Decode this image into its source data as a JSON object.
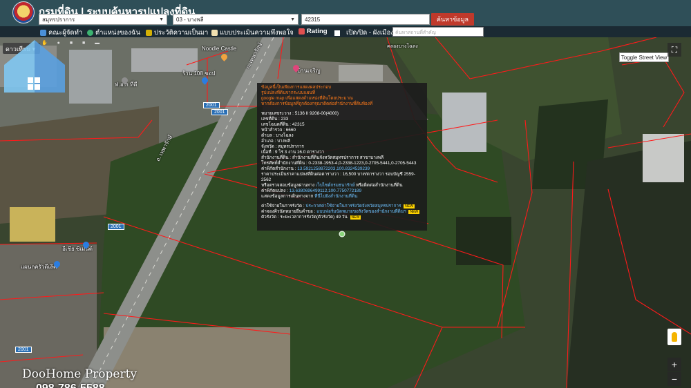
{
  "header": {
    "title": "กรมที่ดิน | ระบบค้นหารูปแปลงที่ดิน",
    "province_select": "สมุทรปราการ",
    "district_select": "03 - บางพลี",
    "parcel_input": "42315",
    "search_button": "ค้นหาข้อมูล"
  },
  "toolbar": {
    "items": [
      {
        "label": "คณะผู้จัดทำ",
        "icon": "team-icon"
      },
      {
        "label": "ตำแหน่งของฉัน",
        "icon": "location-icon"
      },
      {
        "label": "ประวัติความเป็นมา",
        "icon": "history-icon"
      },
      {
        "label": "แบบประเมินความพึงพอใจ",
        "icon": "survey-icon"
      },
      {
        "label": "Rating",
        "icon": "rating-icon"
      },
      {
        "label": "เปิด/ปิด - ผังเมือง",
        "icon": "checkbox-icon"
      }
    ],
    "place_search_placeholder": "ค้นหาสถานที่สำคัญ"
  },
  "map": {
    "map_type": "ดาวเทียม",
    "street_view_toggle": "Toggle Street View",
    "zoom_in": "+",
    "zoom_out": "−",
    "labels": {
      "noodle": "Noodle Castle",
      "shop": "ร้าน 108 ชอป",
      "apartment": "บ้านเจริญ",
      "road_upper": "ถ. เทพารักษ์",
      "road_lower": "ถ. เทพารักษ์",
      "factory": "ฟ.อ.ก ที่ดี",
      "building_left": "อีเชีย ซีเมนต์",
      "building_left2": "แผนกครัวดีเลิศ",
      "canal": "คลองบางโฉลง"
    },
    "road_badges": [
      "2001",
      "2001",
      "2001",
      "2001"
    ]
  },
  "popup": {
    "warning_lines": [
      "ข้อมูลนี้เป็นเพียงการแสดงผลประกอบ",
      "รูปแปลงที่ดินจากระบบแผนที่",
      "google map เพื่อแสดงตำแหน่งที่ดินโดยประมาณ",
      "หากต้องการข้อมูลที่ถูกต้องกรุณาติดต่อสำนักงานที่ดินท้องที่"
    ],
    "rows": [
      "หมายเลขระวาง : 5136 II 9208-00(4000)",
      "เลขที่ดิน : 233",
      "เลขโฉนดที่ดิน : 42315",
      "หน้าสำรวจ : 6660",
      "ตำบล : บางโฉลง",
      "อำเภอ : บางพลี",
      "จังหวัด : สมุทรปราการ",
      "เนื้อที่ : 9 ไร่ 3 งาน 16.0 ตารางวา",
      "สำนักงานที่ดิน : สำนักงานที่ดินจังหวัดสมุทรปราการ สาขาบางพลี",
      "โทรศัพท์สำนักงานที่ดิน : 0-2338-1953-4,0-2338-1223,0-2705-5441,0-2705-5443"
    ],
    "office_coord_label": "ค่าพิกัดสำนักงาน :",
    "office_coord": "13.5921258872203,100.8324539239",
    "price_line": "ราคาประเมินราคาแปลงที่ดินต่อตารางวา : 16,500 บาท/ตารางวา รอบบัญชี 2559-2562",
    "price_check_text": "หรือตรวจสอบข้อมูลผ่านทาง",
    "price_check_link": "เว็บไซต์กรมธนารักษ์",
    "price_check_tail": "หรือติดต่อสำนักงานที่ดิน",
    "parcel_coord_label": "ค่าพิกัดแปลง :",
    "parcel_coord": "13.6380696499112,100.7750772189",
    "route_text": "แสดงข้อมูลการเดินทางจาก",
    "route_link": "ที่นี่ไปยังสำนักงานที่ดิน",
    "fee_label": "ค่าใช้จ่ายในการรังวัด :",
    "fee_link": "ประกาศค่าใช้จ่ายในการรังวัดจังหวัดสมุทรปราการ",
    "queue_label": "ค่าจองคิวนัดหมายยื่นคำขอ :",
    "queue_link": "แบบฟอร์มนัดหมายขอรังวัดของสำนักงานที่ดินฯ",
    "days_label": "ตัวรังวัด : ระยะเวลาการรังวัด(ตัวรังวัด) 49 วัน",
    "new_badge": "NEW"
  },
  "watermark": {
    "brand": "DooHome Property",
    "phone": "098-786-5588"
  }
}
